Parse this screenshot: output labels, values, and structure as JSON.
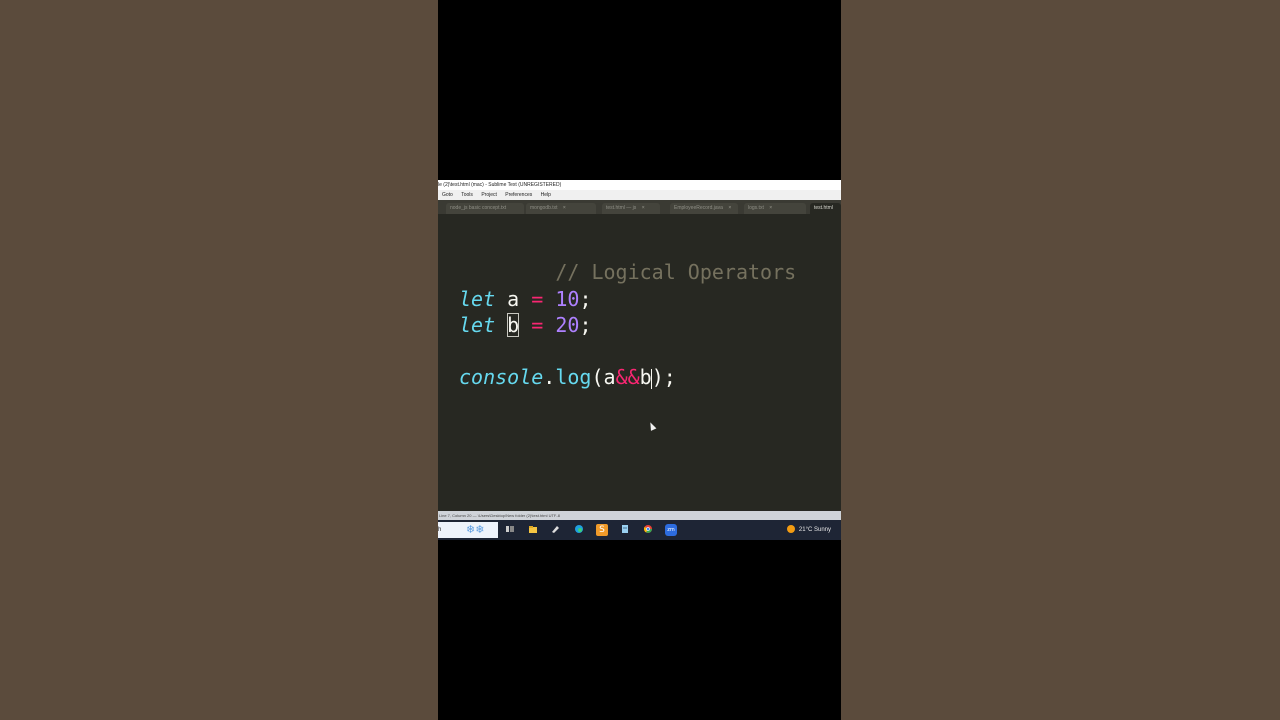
{
  "window": {
    "title": "le (2)\\test.html (mac) - Sublime Text (UNREGISTERED)"
  },
  "menu": [
    "Goto",
    "Tools",
    "Project",
    "Preferences",
    "Help"
  ],
  "tabs": [
    {
      "label": "node_js basic concept.txt",
      "active": false
    },
    {
      "label": "mongodb.txt",
      "active": false
    },
    {
      "label": "test.html — js",
      "active": false
    },
    {
      "label": "EmployeeRecord.java",
      "active": false
    },
    {
      "label": "logs.txt",
      "active": false
    },
    {
      "label": "test.html",
      "active": true
    }
  ],
  "tab_close_glyph": "×",
  "code": {
    "comment": "// Logical Operators",
    "kw_let": "let",
    "var_a": "a",
    "var_b": "b",
    "op_assign": "=",
    "val_a": "10",
    "val_b": "20",
    "semi": ";",
    "console": "console",
    "dot": ".",
    "log": "log",
    "paren_open": "(",
    "op_and": "&&",
    "paren_close_semi": ");"
  },
  "status_bar": {
    "text": "Line 7, Column 20 — \\Users\\Desktop\\New folder (2)\\test.html  UTF-8"
  },
  "taskbar": {
    "search_text": "h",
    "weather_text": "21°C  Sunny",
    "snow_glyph": "❄❄",
    "zoom_label": "zm",
    "sublime_label": "S"
  },
  "colors": {
    "editor_bg": "#272822",
    "comment": "#75715e",
    "keyword": "#66d9ef",
    "operator": "#f92672",
    "number": "#ae81ff",
    "text": "#f8f8f2",
    "outer_bg": "#5b4b3c"
  }
}
